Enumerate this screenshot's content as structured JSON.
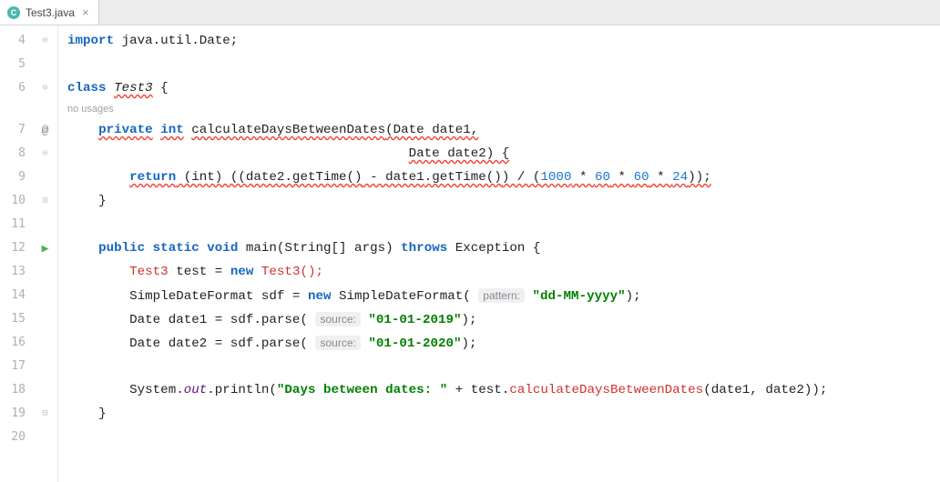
{
  "tab": {
    "filename": "Test3.java"
  },
  "usages_hint": "no usages",
  "param_hints": {
    "pattern": "pattern:",
    "source1": "source:",
    "source2": "source:"
  },
  "line_numbers": [
    "4",
    "5",
    "6",
    "7",
    "8",
    "9",
    "10",
    "11",
    "12",
    "13",
    "14",
    "15",
    "16",
    "17",
    "18",
    "19",
    "20"
  ],
  "tokens": {
    "import": "import",
    "package_path": " java.util.Date;",
    "class_kw": "class",
    "class_name": "Test3",
    "open_brace": " {",
    "private": "private",
    "int": "int",
    "method1": "calculateDaysBetweenDates",
    "param1": "(Date date1,",
    "param2": "Date date2) {",
    "return": "return",
    "cast": " (int) ((date2",
    "getTime": ".getTime()",
    "minus": " - date1",
    "getTime2": ".getTime()",
    "div": ") / (",
    "n1000": "1000",
    "star": " * ",
    "n60": "60",
    "n24": "24",
    "end_expr": "));",
    "close_brace": "}",
    "public": "public",
    "static": "static",
    "void": "void",
    "main": "main",
    "main_args": "(String[] args) ",
    "throws": "throws",
    "exception": " Exception {",
    "test_decl_type": "Test3",
    "test_decl": " test = ",
    "new": "new",
    "test3_ctor": " Test3();",
    "sdf_decl": "SimpleDateFormat sdf = ",
    "sdf_ctor": " SimpleDateFormat(",
    "pattern_str": "\"dd-MM-yyyy\"",
    "close_paren": ");",
    "date1_decl": "Date date1 = sdf.parse(",
    "date1_str": "\"01-01-2019\"",
    "date2_decl": "Date date2 = sdf.parse(",
    "date2_str": "\"01-01-2020\"",
    "system": "System.",
    "out": "out",
    "println": ".println(",
    "msg_str": "\"Days between dates: \"",
    "plus": " + test.",
    "call_method": "calculateDaysBetweenDates",
    "call_args": "(date1, date2));"
  }
}
